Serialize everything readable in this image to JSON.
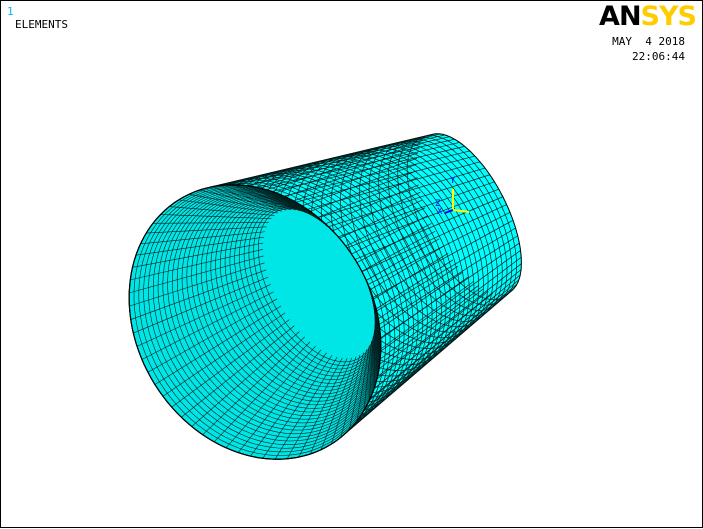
{
  "window": {
    "number": "1",
    "plot_title": "ELEMENTS",
    "date": "MAY  4 2018",
    "time": "22:06:44"
  },
  "logo": {
    "part_black": "AN",
    "part_yellow": "SYS"
  },
  "triad": {
    "y_label": "Y",
    "x_label": "X",
    "z_label": "Z"
  },
  "colors": {
    "mesh_fill": "#00ffff",
    "mesh_fill_inner": "#00e6e6",
    "mesh_lines": "#002020",
    "logo_yellow": "#ffcc00",
    "window_number": "#00b8ff"
  },
  "model": {
    "description_shape": "truncated-cone-shell",
    "mesh_type": "quad-shell"
  }
}
